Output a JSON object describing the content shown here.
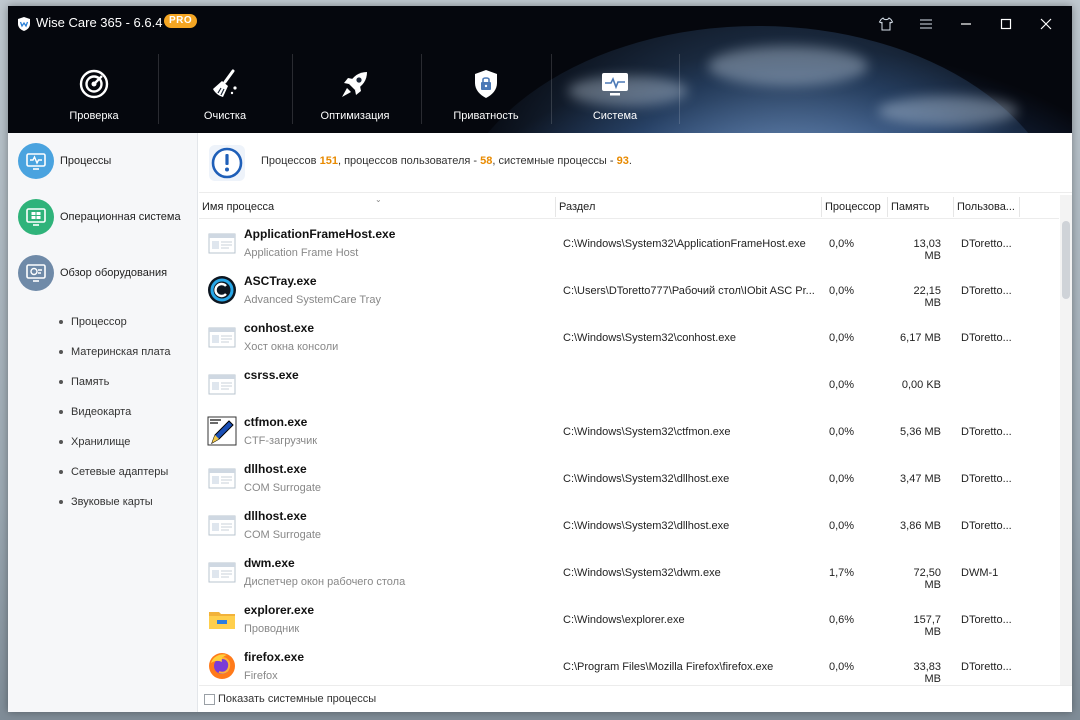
{
  "app": {
    "title": "Wise Care 365 - 6.6.4",
    "badge": "PRO"
  },
  "window_controls": {
    "skin_icon": "shirt-icon",
    "menu_icon": "menu-icon",
    "minimize_icon": "minimize-icon",
    "maximize_icon": "maximize-icon",
    "close_icon": "close-icon"
  },
  "nav": {
    "items": [
      {
        "label": "Проверка",
        "icon": "radar-icon"
      },
      {
        "label": "Очистка",
        "icon": "broom-icon"
      },
      {
        "label": "Оптимизация",
        "icon": "rocket-icon"
      },
      {
        "label": "Приватность",
        "icon": "lock-shield-icon"
      },
      {
        "label": "Система",
        "icon": "monitor-icon"
      }
    ]
  },
  "sidebar": {
    "items": [
      {
        "label": "Процессы",
        "icon": "processes-icon"
      },
      {
        "label": "Операционная система",
        "icon": "windows-icon"
      },
      {
        "label": "Обзор оборудования",
        "icon": "hardware-icon"
      }
    ],
    "subitems": [
      "Процессор",
      "Материнская плата",
      "Память",
      "Видеокарта",
      "Хранилище",
      "Сетевые адаптеры",
      "Звуковые карты"
    ]
  },
  "summary": {
    "prefix": "Процессов",
    "total": "151",
    "user_label": ", процессов пользователя -",
    "user": "58",
    "system_label": ", системные процессы -",
    "system": "93",
    "suffix": "."
  },
  "table": {
    "headers": {
      "name": "Имя процесса",
      "path": "Раздел",
      "cpu": "Процессор",
      "memory": "Память",
      "user": "Пользова..."
    },
    "rows": [
      {
        "name": "ApplicationFrameHost.exe",
        "desc": "Application Frame Host",
        "path": "C:\\Windows\\System32\\ApplicationFrameHost.exe",
        "cpu": "0,0%",
        "mem": "13,03 MB",
        "user": "DToretto...",
        "icon": "window-icon"
      },
      {
        "name": "ASCTray.exe",
        "desc": "Advanced SystemCare Tray",
        "path": "C:\\Users\\DToretto777\\Рабочий стол\\IObit ASC Pr...",
        "cpu": "0,0%",
        "mem": "22,15 MB",
        "user": "DToretto...",
        "icon": "asc-icon"
      },
      {
        "name": "conhost.exe",
        "desc": "Хост окна консоли",
        "path": "C:\\Windows\\System32\\conhost.exe",
        "cpu": "0,0%",
        "mem": "6,17 MB",
        "user": "DToretto...",
        "icon": "window-icon"
      },
      {
        "name": "csrss.exe",
        "desc": "",
        "path": "",
        "cpu": "0,0%",
        "mem": "0,00 KB",
        "user": "",
        "icon": "window-icon"
      },
      {
        "name": "ctfmon.exe",
        "desc": "CTF-загрузчик",
        "path": "C:\\Windows\\System32\\ctfmon.exe",
        "cpu": "0,0%",
        "mem": "5,36 MB",
        "user": "DToretto...",
        "icon": "pen-icon"
      },
      {
        "name": "dllhost.exe",
        "desc": "COM Surrogate",
        "path": "C:\\Windows\\System32\\dllhost.exe",
        "cpu": "0,0%",
        "mem": "3,47 MB",
        "user": "DToretto...",
        "icon": "window-icon"
      },
      {
        "name": "dllhost.exe",
        "desc": "COM Surrogate",
        "path": "C:\\Windows\\System32\\dllhost.exe",
        "cpu": "0,0%",
        "mem": "3,86 MB",
        "user": "DToretto...",
        "icon": "window-icon"
      },
      {
        "name": "dwm.exe",
        "desc": "Диспетчер окон рабочего стола",
        "path": "C:\\Windows\\System32\\dwm.exe",
        "cpu": "1,7%",
        "mem": "72,50 MB",
        "user": "DWM-1",
        "icon": "window-icon"
      },
      {
        "name": "explorer.exe",
        "desc": "Проводник",
        "path": "C:\\Windows\\explorer.exe",
        "cpu": "0,6%",
        "mem": "157,7 MB",
        "user": "DToretto...",
        "icon": "folder-icon"
      },
      {
        "name": "firefox.exe",
        "desc": "Firefox",
        "path": "C:\\Program Files\\Mozilla Firefox\\firefox.exe",
        "cpu": "0,0%",
        "mem": "33,83 MB",
        "user": "DToretto...",
        "icon": "firefox-icon"
      }
    ]
  },
  "footer": {
    "checkbox_label": "Показать системные процессы",
    "checked": false
  },
  "colors": {
    "accent_orange": "#e88a00",
    "pro_badge": "#f5a623",
    "sidebar_icon_blue": "#4aa3df",
    "sidebar_icon_green": "#2fb37a",
    "sidebar_icon_slate": "#6f8aa8"
  }
}
